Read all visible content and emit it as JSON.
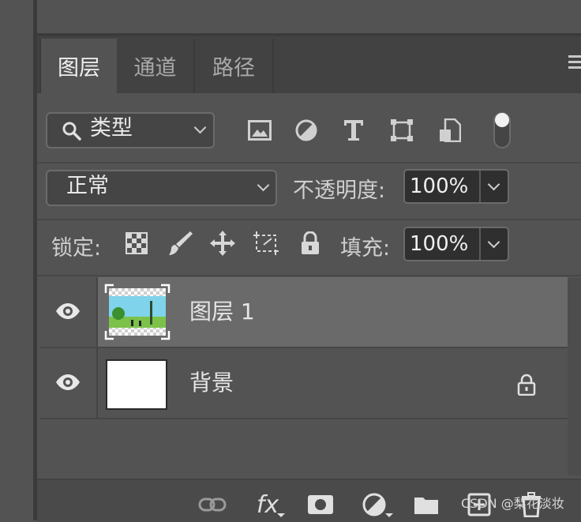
{
  "tabs": [
    {
      "label": "图层",
      "active": true
    },
    {
      "label": "通道",
      "active": false
    },
    {
      "label": "路径",
      "active": false
    }
  ],
  "filter": {
    "kind_label": "类型"
  },
  "blend": {
    "mode": "正常",
    "opacity_label": "不透明度:",
    "opacity_value": "100%"
  },
  "lock": {
    "label": "锁定:",
    "fill_label": "填充:",
    "fill_value": "100%"
  },
  "layers": [
    {
      "name": "图层 1",
      "selected": true,
      "visible": true,
      "locked": false
    },
    {
      "name": "背景",
      "selected": false,
      "visible": true,
      "locked": true
    }
  ],
  "bottom_icons": [
    "link-icon",
    "fx-icon",
    "mask-icon",
    "adjustment-icon",
    "folder-icon",
    "new-layer-icon",
    "trash-icon"
  ],
  "fx_label": "fx",
  "watermark": "CSDN @梨花淡妆",
  "colors": {
    "panel": "#535353",
    "tabbar": "#424242",
    "selected_row": "#6a6a6a",
    "field": "#2f2f2f"
  }
}
